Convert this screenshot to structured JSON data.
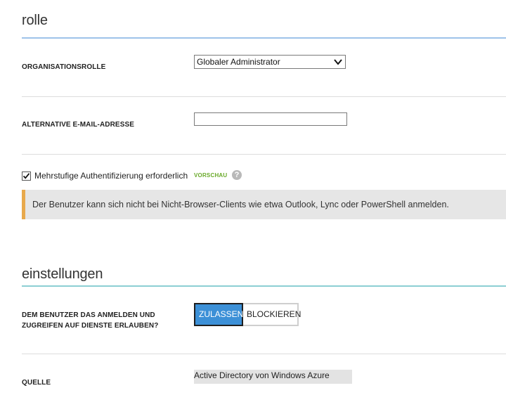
{
  "rolle": {
    "title": "rolle",
    "org_role": {
      "label": "ORGANISATIONSROLLE",
      "selected": "Globaler Administrator"
    },
    "alt_email": {
      "label": "ALTERNATIVE E-MAIL-ADRESSE",
      "value": "",
      "placeholder": ""
    },
    "mfa": {
      "checked": true,
      "label": "Mehrstufige Authentifizierung erforderlich",
      "badge": "VORSCHAU",
      "help": "?"
    },
    "banner": {
      "text": "Der Benutzer kann sich nicht bei Nicht-Browser-Clients wie etwa Outlook, Lync oder PowerShell anmelden."
    }
  },
  "einstellungen": {
    "title": "einstellungen",
    "sign_in": {
      "label_line1": "DEM BENUTZER DAS ANMELDEN UND",
      "label_line2": "ZUGREIFEN AUF DIENSTE ERLAUBEN?",
      "allow": "ZULASSEN",
      "block": "BLOCKIEREN",
      "selected": "ZULASSEN"
    },
    "source": {
      "label": "QUELLE",
      "value": "Active Directory von Windows Azure"
    }
  },
  "colors": {
    "accent_blue": "#3c90d7",
    "rule_blue": "#9ec3ea",
    "rule_teal": "#8ccfd3",
    "banner_accent": "#e8a94c",
    "preview_green": "#6aaa2a"
  }
}
